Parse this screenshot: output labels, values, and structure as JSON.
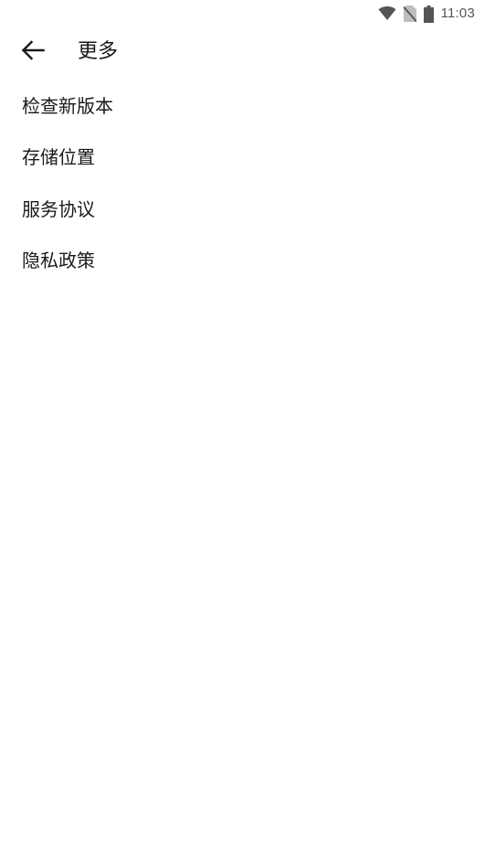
{
  "status_bar": {
    "time": "11:03",
    "icons": [
      "wifi-icon",
      "no-sim-icon",
      "battery-icon"
    ]
  },
  "toolbar": {
    "back_icon": "arrow-left-icon",
    "title": "更多"
  },
  "menu": {
    "items": [
      {
        "label": "检查新版本"
      },
      {
        "label": "存储位置"
      },
      {
        "label": "服务协议"
      },
      {
        "label": "隐私政策"
      }
    ]
  },
  "colors": {
    "background": "#ffffff",
    "text": "#1a1a1a",
    "status_icon": "#555555"
  }
}
